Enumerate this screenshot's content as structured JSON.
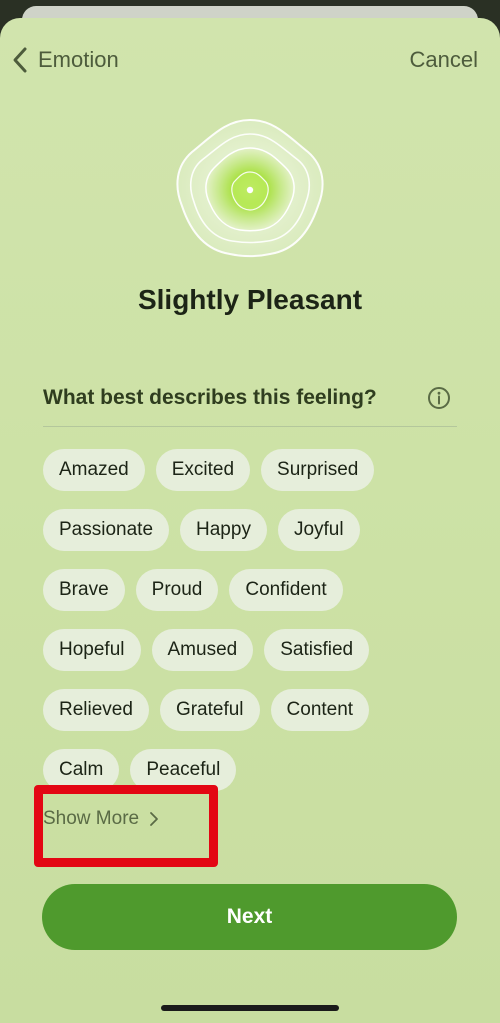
{
  "nav": {
    "back_label": "Emotion",
    "cancel_label": "Cancel"
  },
  "header": {
    "title": "Slightly Pleasant"
  },
  "prompt": {
    "question": "What best describes this feeling?",
    "info_icon": "info-circle-icon"
  },
  "chips": {
    "rows": [
      [
        "Amazed",
        "Excited",
        "Surprised"
      ],
      [
        "Passionate",
        "Happy",
        "Joyful"
      ],
      [
        "Brave",
        "Proud",
        "Confident"
      ],
      [
        "Hopeful",
        "Amused",
        "Satisfied"
      ],
      [
        "Relieved",
        "Grateful",
        "Content"
      ],
      [
        "Calm",
        "Peaceful"
      ]
    ]
  },
  "show_more": {
    "label": "Show More",
    "icon": "chevron-right-icon"
  },
  "actions": {
    "next_label": "Next"
  },
  "colors": {
    "accent": "#4f9a2d",
    "background": "#cde2a6",
    "chip_background": "#e6eedb",
    "highlight": "#e30613"
  }
}
